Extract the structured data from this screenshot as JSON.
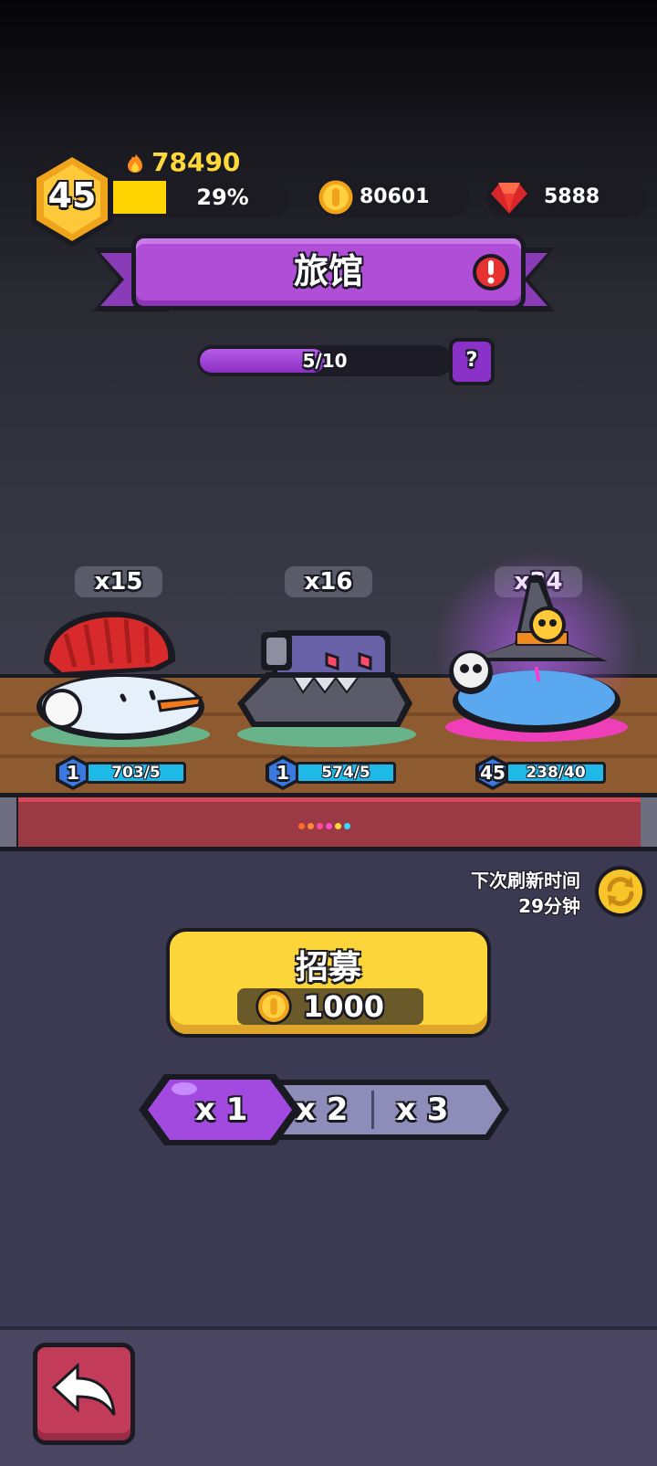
{
  "player": {
    "level": "45",
    "power": "78490",
    "xp_percent_label": "29%",
    "xp_percent": 29,
    "coins": "80601",
    "gems": "5888"
  },
  "header": {
    "title": "旅馆",
    "progress_label": "5/10",
    "progress": 0.5,
    "help_label": "?"
  },
  "heroes": [
    {
      "count": "x15",
      "level": "1",
      "stat": "703/5",
      "name_icon": "snowman-hero-icon"
    },
    {
      "count": "x16",
      "level": "1",
      "stat": "574/5",
      "name_icon": "robot-cannon-hero-icon"
    },
    {
      "count": "x34",
      "level": "45",
      "stat": "238/40",
      "name_icon": "wizard-slime-hero-icon"
    }
  ],
  "refresh": {
    "line1": "下次刷新时间",
    "line2": "29分钟"
  },
  "recruit": {
    "label": "招募",
    "cost": "1000"
  },
  "multipliers": {
    "options": [
      "x 1",
      "x 2",
      "x 3"
    ],
    "selected": "x 1"
  },
  "colors": {
    "accent_purple": "#b04ed8",
    "gold": "#fbd53a",
    "stat_blue": "#1fb9e8",
    "back_red": "#c23c5a"
  }
}
